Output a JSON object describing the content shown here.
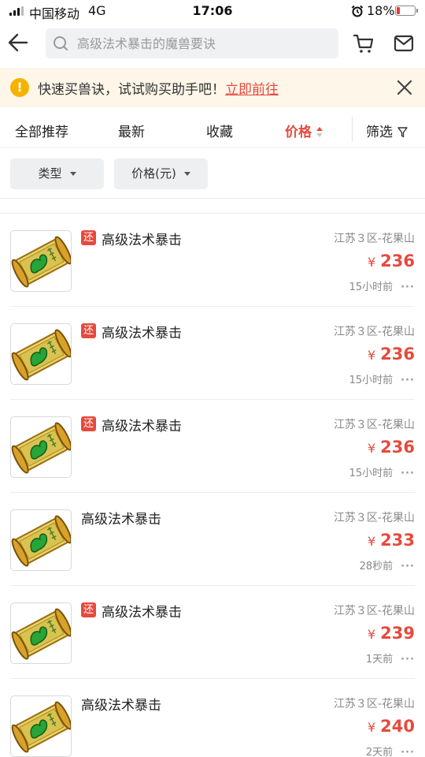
{
  "status_bar": {
    "carrier": "中国移动",
    "network": "4G",
    "time": "17:06",
    "battery": "18%",
    "battery_level": 0.18,
    "battery_color": "#e53935"
  },
  "header": {
    "back_icon": "back-arrow-icon",
    "search_placeholder": "高级法术暴击的魔兽要诀",
    "search_icon": "search-icon",
    "cart_icon": "cart-icon",
    "message_icon": "mail-icon"
  },
  "notice": {
    "icon": "warning-icon",
    "text": "快速买兽诀，试试购买助手吧！",
    "link": "立即前往",
    "close_icon": "close-icon"
  },
  "tabs": [
    {
      "label": "全部推荐"
    },
    {
      "label": "最新"
    },
    {
      "label": "收藏"
    },
    {
      "label": "价格",
      "active": true
    },
    {
      "label": "筛选"
    }
  ],
  "filters": [
    {
      "label": "类型"
    },
    {
      "label": "价格(元)"
    }
  ],
  "colors": {
    "accent": "#e64a3c",
    "notice_bg": "#fdf6e9",
    "warn": "#f5b300"
  },
  "items": [
    {
      "badge": "还",
      "title": "高级法术暴击",
      "server": "江苏３区-花果山",
      "currency": "¥",
      "price": "236",
      "time": "15小时前"
    },
    {
      "badge": "还",
      "title": "高级法术暴击",
      "server": "江苏３区-花果山",
      "currency": "¥",
      "price": "236",
      "time": "15小时前"
    },
    {
      "badge": "还",
      "title": "高级法术暴击",
      "server": "江苏３区-花果山",
      "currency": "¥",
      "price": "236",
      "time": "15小时前"
    },
    {
      "badge": "",
      "title": "高级法术暴击",
      "server": "江苏３区-花果山",
      "currency": "¥",
      "price": "233",
      "time": "28秒前"
    },
    {
      "badge": "还",
      "title": "高级法术暴击",
      "server": "江苏３区-花果山",
      "currency": "¥",
      "price": "239",
      "time": "1天前"
    },
    {
      "badge": "",
      "title": "高级法术暴击",
      "server": "江苏３区-花果山",
      "currency": "¥",
      "price": "240",
      "time": "2天前"
    }
  ]
}
